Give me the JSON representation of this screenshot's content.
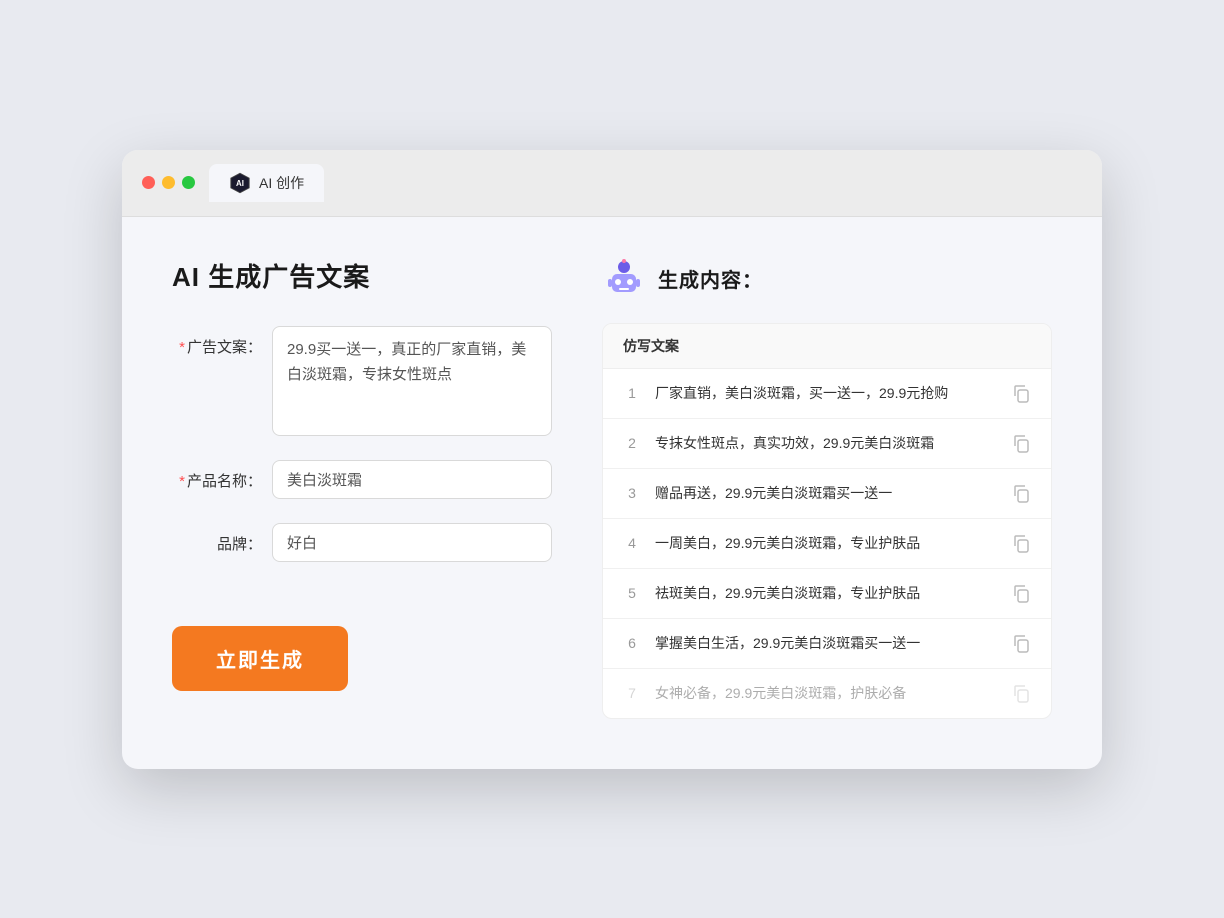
{
  "browser": {
    "traffic_lights": [
      "red",
      "yellow",
      "green"
    ],
    "tab_label": "AI 创作"
  },
  "left_panel": {
    "title": "AI 生成广告文案",
    "fields": [
      {
        "name": "ad_copy",
        "label": "广告文案：",
        "required": true,
        "value": "29.9买一送一，真正的厂家直销，美白淡斑霜，专抹女性斑点",
        "type": "textarea",
        "placeholder": ""
      },
      {
        "name": "product_name",
        "label": "产品名称：",
        "required": true,
        "value": "美白淡斑霜",
        "type": "input",
        "placeholder": ""
      },
      {
        "name": "brand",
        "label": "品牌：",
        "required": false,
        "value": "好白",
        "type": "input",
        "placeholder": ""
      }
    ],
    "generate_button": "立即生成"
  },
  "right_panel": {
    "title": "生成内容：",
    "table_header": "仿写文案",
    "results": [
      {
        "num": "1",
        "text": "厂家直销，美白淡斑霜，买一送一，29.9元抢购",
        "faded": false
      },
      {
        "num": "2",
        "text": "专抹女性斑点，真实功效，29.9元美白淡斑霜",
        "faded": false
      },
      {
        "num": "3",
        "text": "赠品再送，29.9元美白淡斑霜买一送一",
        "faded": false
      },
      {
        "num": "4",
        "text": "一周美白，29.9元美白淡斑霜，专业护肤品",
        "faded": false
      },
      {
        "num": "5",
        "text": "祛斑美白，29.9元美白淡斑霜，专业护肤品",
        "faded": false
      },
      {
        "num": "6",
        "text": "掌握美白生活，29.9元美白淡斑霜买一送一",
        "faded": false
      },
      {
        "num": "7",
        "text": "女神必备，29.9元美白淡斑霜，护肤必备",
        "faded": true
      }
    ]
  },
  "colors": {
    "accent": "#f47920",
    "required": "#ff4d4f"
  }
}
